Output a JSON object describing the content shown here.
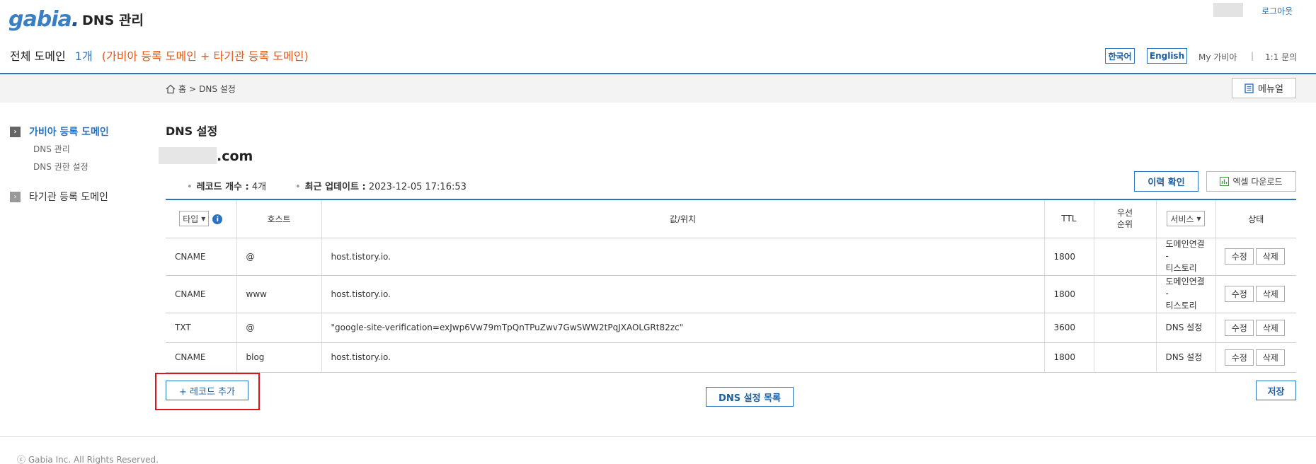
{
  "header": {
    "logo_text": "gabia",
    "app_title": "DNS 관리",
    "logout": "로그아웃",
    "domain_label": "전체 도메인",
    "domain_count": "1개",
    "domain_desc": "(가비아 등록 도메인 + 타기관 등록 도메인)",
    "lang_ko": "한국어",
    "lang_en": "English",
    "my_gabia": "My 가비아",
    "separator": "|",
    "inquiry": "1:1 문의"
  },
  "breadcrumb": {
    "home": "홈",
    "sep": ">",
    "current": "DNS 설정"
  },
  "manual_label": "메뉴얼",
  "sidebar": {
    "gabia_domains": "가비아 등록 도메인",
    "sub_items": [
      "DNS 관리",
      "DNS 권한 설정"
    ],
    "other_domains": "타기관 등록 도메인"
  },
  "main": {
    "title": "DNS 설정",
    "domain_suffix": ".com",
    "record_count_label": "레코드 개수 :",
    "record_count": "4개",
    "updated_label": "최근 업데이트 :",
    "updated": "2023-12-05 17:16:53",
    "history_btn": "이력 확인",
    "excel_btn": "엑셀 다운로드"
  },
  "table": {
    "type_select": "타입",
    "host": "호스트",
    "value": "값/위치",
    "ttl": "TTL",
    "priority_line1": "우선",
    "priority_line2": "순위",
    "service_select": "서비스",
    "status": "상태",
    "edit_label": "수정",
    "delete_label": "삭제",
    "rows": [
      {
        "type": "CNAME",
        "host": "@",
        "value": "host.tistory.io.",
        "ttl": "1800",
        "priority": "",
        "service1": "도메인연결 -",
        "service2": "티스토리"
      },
      {
        "type": "CNAME",
        "host": "www",
        "value": "host.tistory.io.",
        "ttl": "1800",
        "priority": "",
        "service1": "도메인연결 -",
        "service2": "티스토리"
      },
      {
        "type": "TXT",
        "host": "@",
        "value": "\"google-site-verification=exJwp6Vw79mTpQnTPuZwv7GwSWW2tPqJXAOLGRt82zc\"",
        "ttl": "3600",
        "priority": "",
        "service1": "DNS 설정",
        "service2": ""
      },
      {
        "type": "CNAME",
        "host": "blog",
        "value": "host.tistory.io.",
        "ttl": "1800",
        "priority": "",
        "service1": "DNS 설정",
        "service2": ""
      }
    ]
  },
  "buttons": {
    "add_record": "+ 레코드 추가",
    "dns_list": "DNS 설정 목록",
    "save": "저장"
  },
  "footer": "ⓒ Gabia Inc. All Rights Reserved.",
  "colors": {
    "accent": "#2a73c0",
    "highlight": "#e0141e",
    "orange_text": "#e05a1a"
  }
}
